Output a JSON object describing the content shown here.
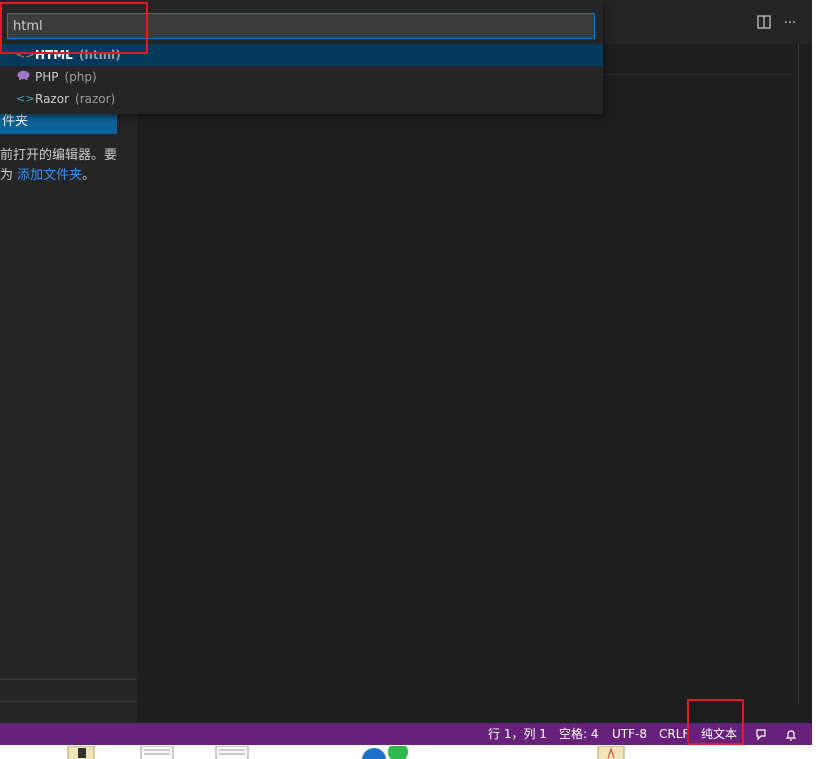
{
  "quick_pick": {
    "input_value": "html",
    "items": [
      {
        "label": "HTML",
        "desc": "(html)",
        "icon": "html-file-icon",
        "selected": true
      },
      {
        "label": "PHP",
        "desc": "(php)",
        "icon": "php-elephant-icon",
        "selected": false
      },
      {
        "label": "Razor",
        "desc": "(razor)",
        "icon": "code-brackets-icon",
        "selected": false
      }
    ]
  },
  "sidebar": {
    "open_folder_label": "件夹",
    "message_line1": "前打开的编辑器。要",
    "message_line2_prefix": "为 ",
    "message_link": "添加文件夹",
    "message_suffix": "。"
  },
  "editor_actions": {
    "split_icon": "split-editor-icon",
    "more_label": "···"
  },
  "status_bar": {
    "position": "行 1，列 1",
    "indent": "空格: 4",
    "encoding": "UTF-8",
    "eol": "CRLF",
    "language": "纯文本",
    "feedback_icon": "feedback-icon",
    "bell_icon": "bell-icon"
  },
  "colors": {
    "status_bar_bg": "#68217a",
    "accent": "#007fd4",
    "annotation": "#e01b24",
    "selected_item_bg": "#04395e"
  }
}
